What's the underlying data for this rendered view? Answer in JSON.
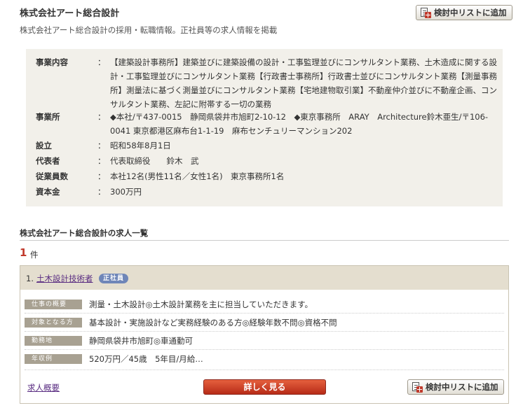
{
  "company": {
    "name": "株式会社アート総合設計",
    "description": "株式会社アート総合設計の採用・転職情報。正社員等の求人情報を掲載"
  },
  "add_to_list_label": "検討中リストに追加",
  "info": {
    "rows": [
      {
        "label": "事業内容",
        "colon": "：",
        "value": "【建築設計事務所】建築並びに建築設備の設計・工事監理並びにコンサルタント業務、土木造成に関する設計・工事監理並びにコンサルタント業務【行政書士事務所】行政書士並びにコンサルタント業務【測量事務所】測量法に基づく測量並びにコンサルタント業務【宅地建物取引業】不動産仲介並びに不動産企画、コンサルタント業務、左記に附帯する一切の業務"
      },
      {
        "label": "事業所",
        "colon": "：",
        "value": "◆本社/〒437-0015　静岡県袋井市旭町2-10-12　◆東京事務所　ARAY　Architecture鈴木亜生/〒106-0041 東京都港区麻布台1-1-19　麻布センチュリーマンション202"
      },
      {
        "label": "設立",
        "colon": "：",
        "value": "昭和58年8月1日"
      },
      {
        "label": "代表者",
        "colon": "：",
        "value": "代表取締役　　鈴木　武"
      },
      {
        "label": "従業員数",
        "colon": "：",
        "value": "本社12名(男性11名／女性1名)　東京事務所1名"
      },
      {
        "label": "資本金",
        "colon": "：",
        "value": "300万円"
      }
    ]
  },
  "job_list": {
    "heading": "株式会社アート総合設計の求人一覧",
    "count": "1",
    "count_unit": "件"
  },
  "job": {
    "index": "1.",
    "title": "土木設計技術者",
    "badge": "正社員",
    "rows": [
      {
        "tag": "仕事の概要",
        "text": "測量・土木設計◎土木設計業務を主に担当していただきます。"
      },
      {
        "tag": "対象となる方",
        "text": "基本設計・実施設計など実務経験のある方◎経験年数不問◎資格不問"
      },
      {
        "tag": "勤務地",
        "text": "静岡県袋井市旭町◎車通勤可"
      },
      {
        "tag": "年収例",
        "text": "520万円／45歳　5年目/月給…"
      }
    ],
    "summary_link": "求人概要",
    "detail_button": "詳しく見る"
  }
}
